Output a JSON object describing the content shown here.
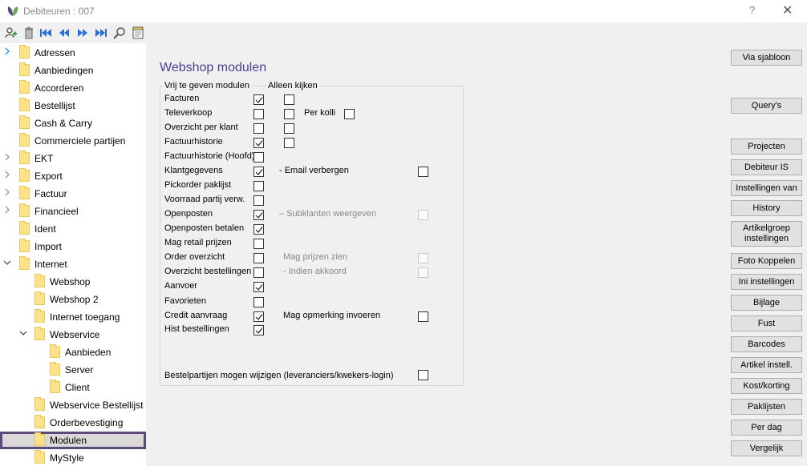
{
  "window": {
    "title": "Debiteuren : 007",
    "help": "?",
    "close": "✕"
  },
  "toolbar": {
    "icons": [
      "add-user-icon",
      "delete-icon",
      "first-icon",
      "previous-icon",
      "next-icon",
      "last-icon",
      "search-icon",
      "notes-icon"
    ]
  },
  "sidebar": {
    "items": [
      {
        "label": "Adressen",
        "level": 0,
        "chevron": "right-blue"
      },
      {
        "label": "Aanbiedingen",
        "level": 0,
        "chevron": ""
      },
      {
        "label": "Accorderen",
        "level": 0,
        "chevron": ""
      },
      {
        "label": "Bestellijst",
        "level": 0,
        "chevron": ""
      },
      {
        "label": "Cash & Carry",
        "level": 0,
        "chevron": ""
      },
      {
        "label": "Commerciele partijen",
        "level": 0,
        "chevron": ""
      },
      {
        "label": "EKT",
        "level": 0,
        "chevron": "right"
      },
      {
        "label": "Export",
        "level": 0,
        "chevron": "right"
      },
      {
        "label": "Factuur",
        "level": 0,
        "chevron": "right"
      },
      {
        "label": "Financieel",
        "level": 0,
        "chevron": "right"
      },
      {
        "label": "Ident",
        "level": 0,
        "chevron": ""
      },
      {
        "label": "Import",
        "level": 0,
        "chevron": ""
      },
      {
        "label": "Internet",
        "level": 0,
        "chevron": "down"
      },
      {
        "label": "Webshop",
        "level": 1,
        "chevron": ""
      },
      {
        "label": "Webshop 2",
        "level": 1,
        "chevron": ""
      },
      {
        "label": "Internet toegang",
        "level": 1,
        "chevron": ""
      },
      {
        "label": "Webservice",
        "level": 1,
        "chevron": "down"
      },
      {
        "label": "Aanbieden",
        "level": 2,
        "chevron": ""
      },
      {
        "label": "Server",
        "level": 2,
        "chevron": ""
      },
      {
        "label": "Client",
        "level": 2,
        "chevron": ""
      },
      {
        "label": "Webservice Bestellijst",
        "level": 1,
        "chevron": ""
      },
      {
        "label": "Orderbevestiging",
        "level": 1,
        "chevron": ""
      },
      {
        "label": "Modulen",
        "level": 1,
        "chevron": "",
        "selected": true
      },
      {
        "label": "MyStyle",
        "level": 1,
        "chevron": ""
      }
    ]
  },
  "main": {
    "title": "Webshop modulen",
    "group_header_left": "Vrij te geven modulen",
    "group_header_right": "Alleen kijken",
    "modules": [
      {
        "label": "Facturen",
        "checked": true,
        "view_only": false
      },
      {
        "label": "Televerkoop",
        "checked": false,
        "view_only": false
      },
      {
        "label": "Overzicht per klant",
        "checked": false,
        "view_only": false
      },
      {
        "label": "Factuurhistorie",
        "checked": true,
        "view_only": false
      },
      {
        "label": "Factuurhistorie (Hoofd)",
        "checked": false
      },
      {
        "label": "Klantgegevens",
        "checked": true
      },
      {
        "label": "Pickorder paklijst",
        "checked": false
      },
      {
        "label": "Voorraad partij verw.",
        "checked": false
      },
      {
        "label": "Openposten",
        "checked": true
      },
      {
        "label": "Openposten betalen",
        "checked": true
      },
      {
        "label": "Mag retail prijzen",
        "checked": false
      },
      {
        "label": "Order overzicht",
        "checked": false
      },
      {
        "label": "Overzicht bestellingen",
        "checked": false
      },
      {
        "label": "Aanvoer",
        "checked": true
      },
      {
        "label": "Favorieten",
        "checked": false
      },
      {
        "label": "Credit aanvraag",
        "checked": true
      },
      {
        "label": "Hist bestellingen",
        "checked": true
      }
    ],
    "extras": {
      "per_kolli": {
        "label": "Per kolli",
        "checked": false
      },
      "email_verbergen": {
        "label": "- Email verbergen",
        "checked": false
      },
      "subklanten": {
        "label": "– Subklanten weergeven",
        "checked": false
      },
      "mag_prijzen_zien": {
        "label": "Mag prijzen zien",
        "checked": false
      },
      "indien_akkoord": {
        "label": "- Indien akkoord",
        "checked": false
      },
      "mag_opmerking": {
        "label": "Mag opmerking invoeren",
        "checked": false
      },
      "bestelpartijen": {
        "label": "Bestelpartijen mogen wijzigen (leveranciers/kwekers-login)",
        "checked": false
      }
    }
  },
  "buttons": {
    "via_sjabloon": "Via sjabloon",
    "querys": "Query's",
    "projecten": "Projecten",
    "debiteur_is": "Debiteur IS",
    "instellingen_van": "Instellingen van",
    "history": "History",
    "artikelgroep": "Artikelgroep instellingen",
    "foto_koppelen": "Foto Koppelen",
    "ini_instellingen": "Ini instellingen",
    "bijlage": "Bijlage",
    "fust": "Fust",
    "barcodes": "Barcodes",
    "artikel_instell": "Artikel instell.",
    "kost_korting": "Kost/korting",
    "paklijsten": "Paklijsten",
    "per_dag": "Per dag",
    "vergelijk": "Vergelijk"
  },
  "colors": {
    "title": "#4b3f8f",
    "selection_border": "#5b4a7a",
    "folder": "#fce38a"
  }
}
